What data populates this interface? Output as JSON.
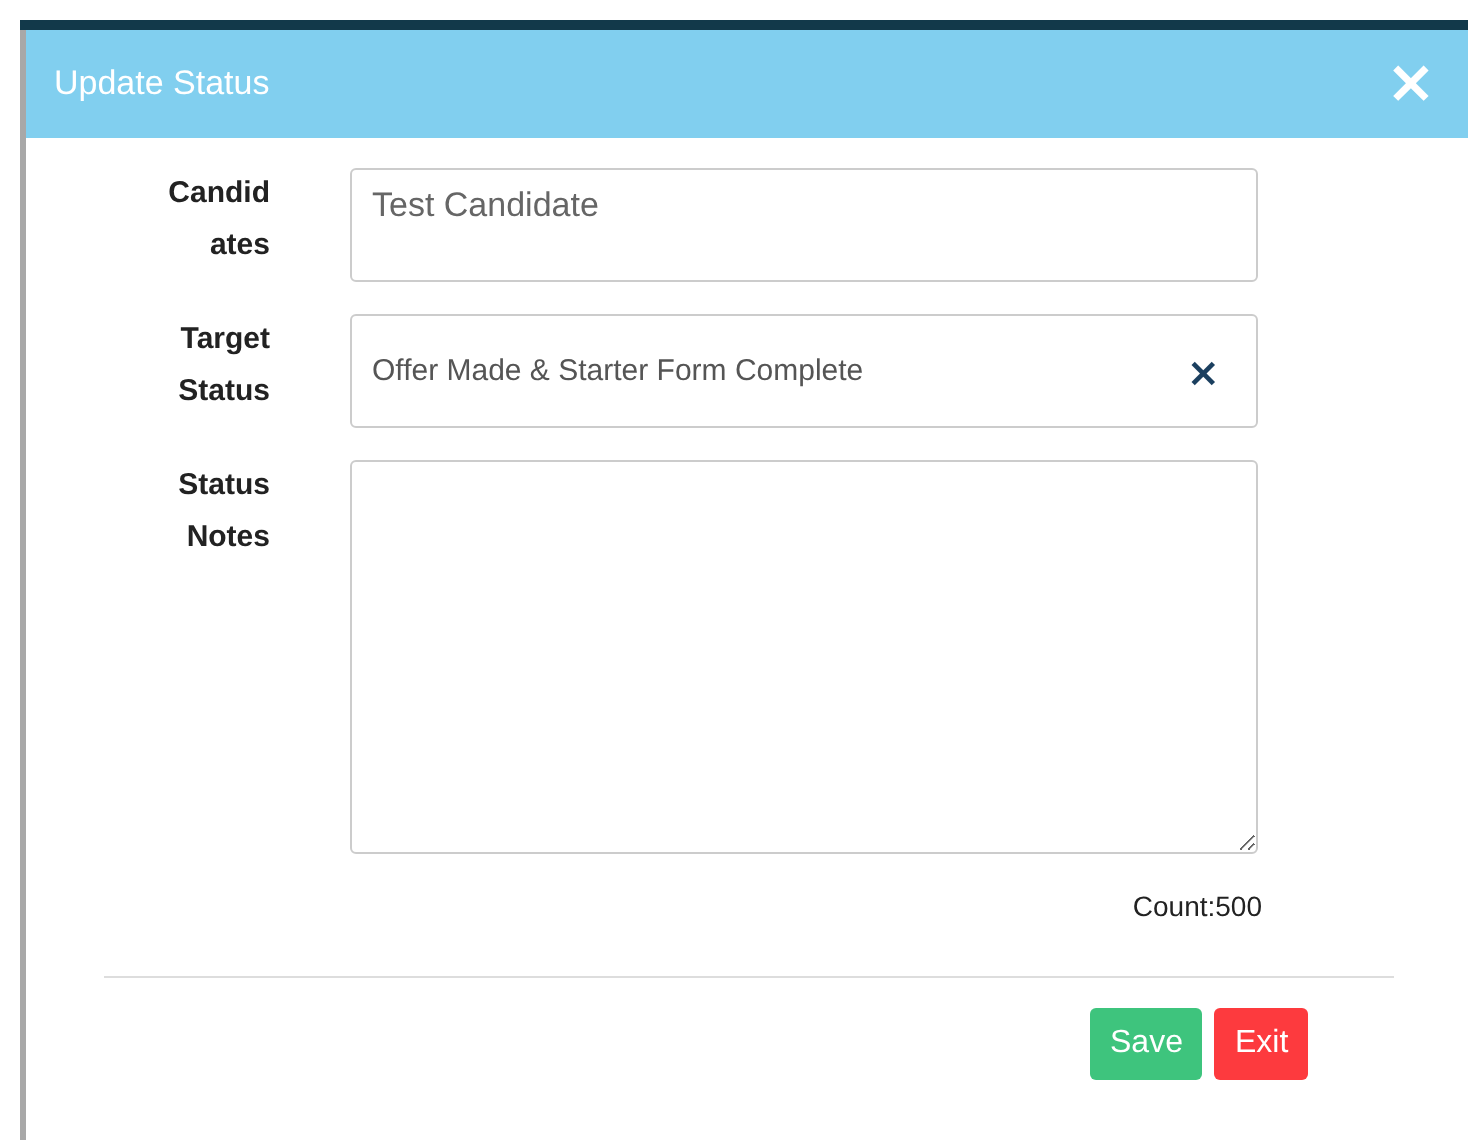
{
  "dialog": {
    "title": "Update Status",
    "close": "×"
  },
  "fields": [
    {
      "kind": "text",
      "label": "Candidates",
      "value": "Test Candidate"
    },
    {
      "kind": "select",
      "label": "Target Status",
      "value": "Offer Made & Starter Form Complete",
      "clear": "×"
    },
    {
      "kind": "textarea",
      "label": "Status Notes"
    }
  ],
  "count": "Count:500",
  "buttons": [
    {
      "kind": "save",
      "label": "Save"
    },
    {
      "kind": "exit",
      "label": "Exit"
    }
  ]
}
